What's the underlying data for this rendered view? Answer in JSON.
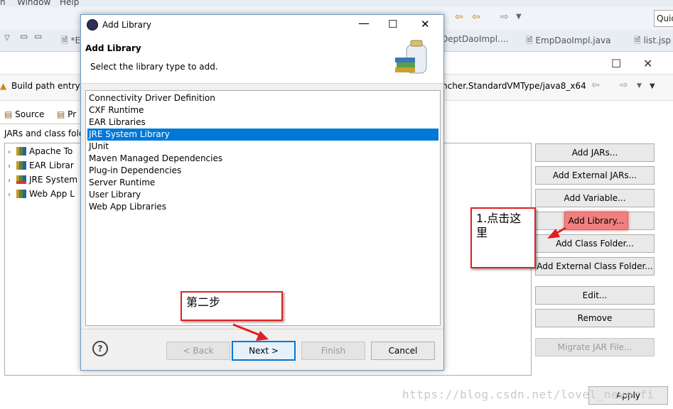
{
  "top": {
    "menu_items": [
      "n",
      "Window",
      "Help"
    ],
    "quick_access": "Quic",
    "editor_tabs": [
      "*E",
      "DeptDaoImpl....",
      "EmpDaoImpl.java",
      "list.jsp"
    ]
  },
  "properties": {
    "build_path_label": "Build path entry",
    "path_text": "ncher.StandardVMType/java8_x64",
    "tabs": [
      "Source",
      "Pr"
    ],
    "jars_label": "JARs and class fold",
    "tree_items": [
      "Apache To",
      "EAR Librar",
      "JRE System",
      "Web App L"
    ],
    "buttons": {
      "add_jars": "Add JARs...",
      "add_external_jars": "Add External JARs...",
      "add_variable": "Add Variable...",
      "add_library": "Add Library...",
      "add_class_folder": "Add Class Folder...",
      "add_external_class_folder": "Add External Class Folder...",
      "edit": "Edit...",
      "remove": "Remove",
      "migrate_jar": "Migrate JAR File...",
      "apply": "Apply"
    }
  },
  "dialog": {
    "title": "Add Library",
    "header_title": "Add Library",
    "header_subtitle": "Select the library type to add.",
    "library_types": [
      "Connectivity Driver Definition",
      "CXF Runtime",
      "EAR Libraries",
      "JRE System Library",
      "JUnit",
      "Maven Managed Dependencies",
      "Plug-in Dependencies",
      "Server Runtime",
      "User Library",
      "Web App Libraries"
    ],
    "selected_index": 3,
    "buttons": {
      "back": "< Back",
      "next": "Next >",
      "finish": "Finish",
      "cancel": "Cancel"
    },
    "help_glyph": "?"
  },
  "annotations": {
    "step1": "1.点击这里",
    "step2": "第二步"
  },
  "watermark": "https://blog.csdn.net/lovel_neverfi",
  "colors": {
    "selection": "#0078d7",
    "annotation_red": "#e02020",
    "add_library_highlight": "#f08080"
  }
}
